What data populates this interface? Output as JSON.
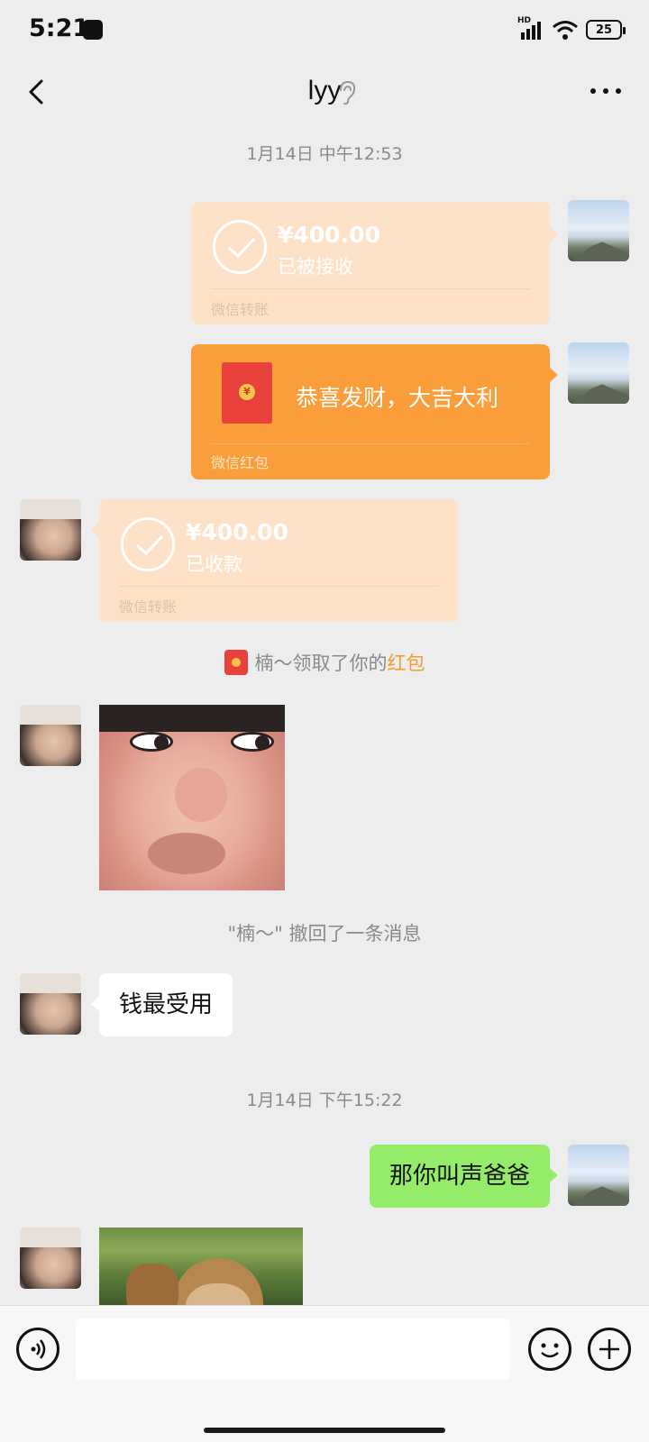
{
  "status_bar": {
    "time": "5:21",
    "signal_label": "HD",
    "battery": "25"
  },
  "header": {
    "title": "lyy"
  },
  "messages": {
    "timestamp_1": "1月14日 中午12:53",
    "transfer_out": {
      "amount": "¥400.00",
      "status": "已被接收",
      "footer": "微信转账"
    },
    "red_packet": {
      "greeting": "恭喜发财，大吉大利",
      "footer": "微信红包"
    },
    "transfer_in": {
      "amount": "¥400.00",
      "status": "已收款",
      "footer": "微信转账"
    },
    "redpacket_notice": {
      "text": "楠～领取了你的",
      "highlight": "红包"
    },
    "recall_notice": "\"楠～\" 撤回了一条消息",
    "text_in": "钱最受用",
    "timestamp_2": "1月14日 下午15:22",
    "text_out": "那你叫声爸爸"
  },
  "input_bar": {
    "placeholder": ""
  },
  "colors": {
    "background": "#ededed",
    "transfer_card": "#fde2c7",
    "red_packet_card": "#fa9d3b",
    "bubble_green": "#95ec69",
    "highlight": "#f39c2e"
  }
}
